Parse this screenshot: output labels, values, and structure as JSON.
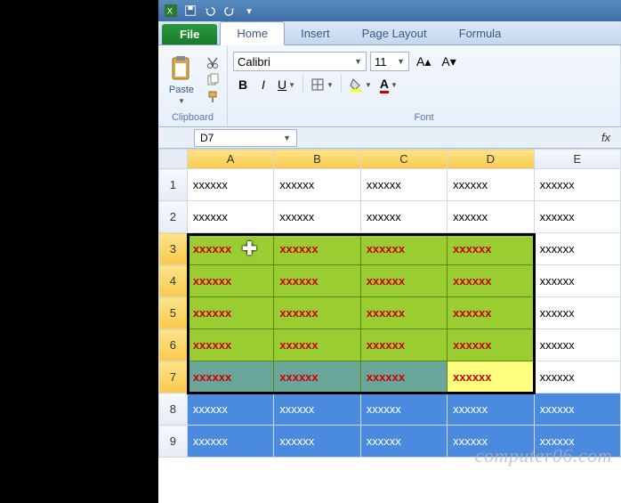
{
  "qat": {
    "icons": [
      "excel",
      "save",
      "undo",
      "redo",
      "dropdown",
      "dropdown2",
      "print"
    ]
  },
  "tabs": {
    "file": "File",
    "home": "Home",
    "insert": "Insert",
    "page_layout": "Page Layout",
    "formulas": "Formula"
  },
  "ribbon": {
    "clipboard": {
      "label": "Clipboard",
      "paste": "Paste"
    },
    "font": {
      "label": "Font",
      "name": "Calibri",
      "size": "11",
      "bold": "B",
      "italic": "I",
      "underline": "U"
    }
  },
  "namebox": "D7",
  "fx_label": "fx",
  "columns": [
    "A",
    "B",
    "C",
    "D",
    "E"
  ],
  "rows": [
    "1",
    "2",
    "3",
    "4",
    "5",
    "6",
    "7",
    "8",
    "9"
  ],
  "cell_value": "xxxxxx",
  "watermark": "computer06.com",
  "chart_data": {
    "type": "table",
    "active_cell": "D7",
    "selection": "A3:D7",
    "columns": [
      "A",
      "B",
      "C",
      "D",
      "E"
    ],
    "data": [
      {
        "row": 1,
        "A": "xxxxxx",
        "B": "xxxxxx",
        "C": "xxxxxx",
        "D": "xxxxxx",
        "E": "xxxxxx"
      },
      {
        "row": 2,
        "A": "xxxxxx",
        "B": "xxxxxx",
        "C": "xxxxxx",
        "D": "xxxxxx",
        "E": "xxxxxx"
      },
      {
        "row": 3,
        "A": "xxxxxx",
        "B": "xxxxxx",
        "C": "xxxxxx",
        "D": "xxxxxx",
        "E": "xxxxxx"
      },
      {
        "row": 4,
        "A": "xxxxxx",
        "B": "xxxxxx",
        "C": "xxxxxx",
        "D": "xxxxxx",
        "E": "xxxxxx"
      },
      {
        "row": 5,
        "A": "xxxxxx",
        "B": "xxxxxx",
        "C": "xxxxxx",
        "D": "xxxxxx",
        "E": "xxxxxx"
      },
      {
        "row": 6,
        "A": "xxxxxx",
        "B": "xxxxxx",
        "C": "xxxxxx",
        "D": "xxxxxx",
        "E": "xxxxxx"
      },
      {
        "row": 7,
        "A": "xxxxxx",
        "B": "xxxxxx",
        "C": "xxxxxx",
        "D": "xxxxxx",
        "E": "xxxxxx"
      },
      {
        "row": 8,
        "A": "xxxxxx",
        "B": "xxxxxx",
        "C": "xxxxxx",
        "D": "xxxxxx",
        "E": "xxxxxx"
      },
      {
        "row": 9,
        "A": "xxxxxx",
        "B": "xxxxxx",
        "C": "xxxxxx",
        "D": "xxxxxx",
        "E": "xxxxxx"
      }
    ],
    "highlighted_range": {
      "from": "A3",
      "to": "D7",
      "fill": "#9acd32",
      "font_color": "#cc0000",
      "bold": true
    }
  }
}
